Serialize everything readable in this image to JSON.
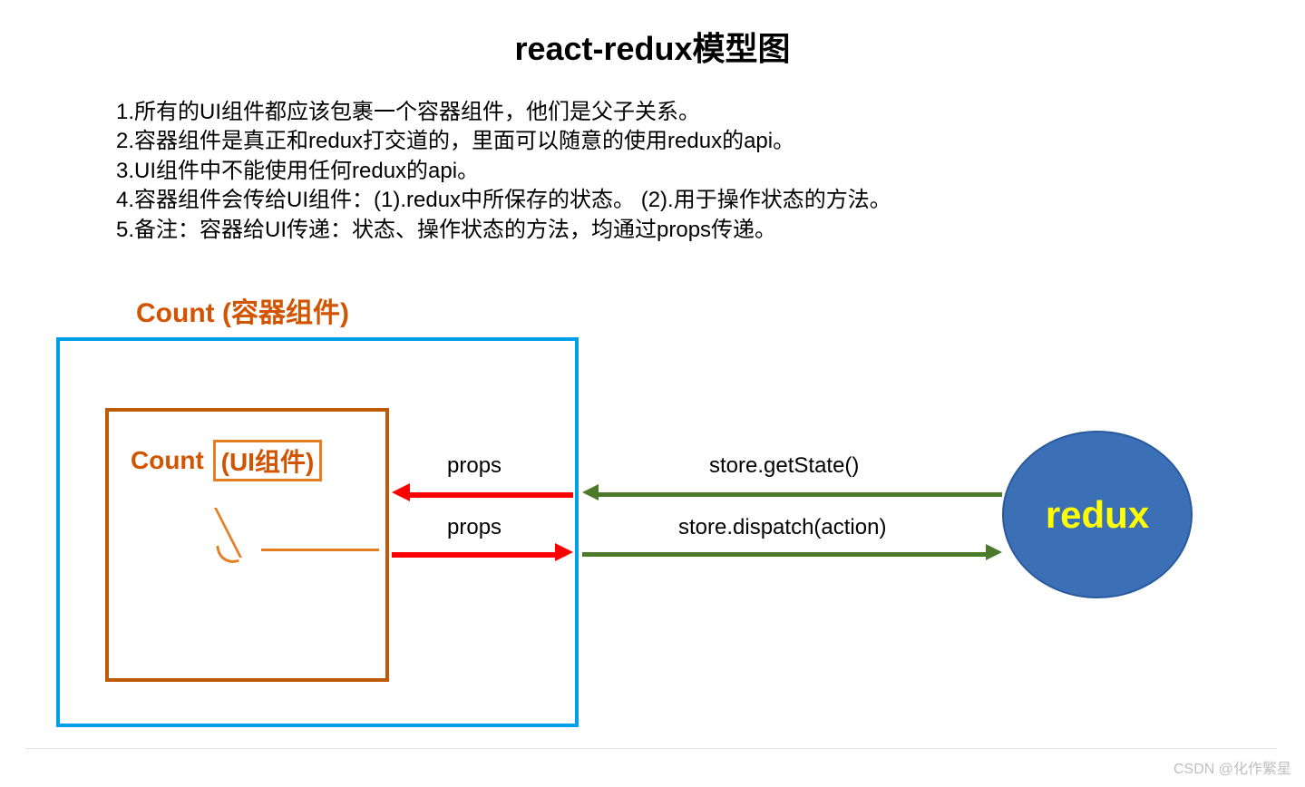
{
  "title": "react-redux模型图",
  "notes": [
    "1.所有的UI组件都应该包裹一个容器组件，他们是父子关系。",
    "2.容器组件是真正和redux打交道的，里面可以随意的使用redux的api。",
    "3.UI组件中不能使用任何redux的api。",
    "4.容器组件会传给UI组件：(1).redux中所保存的状态。  (2).用于操作状态的方法。",
    "5.备注：容器给UI传递：状态、操作状态的方法，均通过props传递。"
  ],
  "container_label": "Count (容器组件)",
  "ui_label_prefix": "Count",
  "ui_label_boxed": "(UI组件)",
  "arrows": {
    "red_in_label": "props",
    "red_out_label": "props",
    "green_in_label": "store.getState()",
    "green_out_label": "store.dispatch(action)"
  },
  "redux_label": "redux",
  "watermark": "CSDN @化作繁星",
  "colors": {
    "container_border": "#00a0e9",
    "ui_border": "#c05a05",
    "accent_orange": "#d35400",
    "arrow_red": "#ff0000",
    "arrow_green": "#4b7b2a",
    "redux_fill": "#3b6fb6",
    "redux_text": "#ffff00"
  },
  "chart_data": {
    "type": "diagram",
    "title": "react-redux模型图",
    "nodes": [
      {
        "id": "container",
        "label": "Count (容器组件)",
        "kind": "container-component"
      },
      {
        "id": "ui",
        "label": "Count (UI组件)",
        "kind": "ui-component",
        "parent": "container"
      },
      {
        "id": "redux",
        "label": "redux",
        "kind": "store"
      }
    ],
    "edges": [
      {
        "from": "redux",
        "to": "container",
        "label": "store.getState()",
        "color": "green",
        "direction": "left"
      },
      {
        "from": "container",
        "to": "redux",
        "label": "store.dispatch(action)",
        "color": "green",
        "direction": "right"
      },
      {
        "from": "container",
        "to": "ui",
        "label": "props",
        "color": "red",
        "direction": "left"
      },
      {
        "from": "ui",
        "to": "container",
        "label": "props",
        "color": "red",
        "direction": "right"
      }
    ],
    "annotations": [
      "所有的UI组件都应该包裹一个容器组件，他们是父子关系。",
      "容器组件是真正和redux打交道的，里面可以随意的使用redux的api。",
      "UI组件中不能使用任何redux的api。",
      "容器组件会传给UI组件：(1).redux中所保存的状态。 (2).用于操作状态的方法。",
      "备注：容器给UI传递：状态、操作状态的方法，均通过props传递。"
    ]
  }
}
